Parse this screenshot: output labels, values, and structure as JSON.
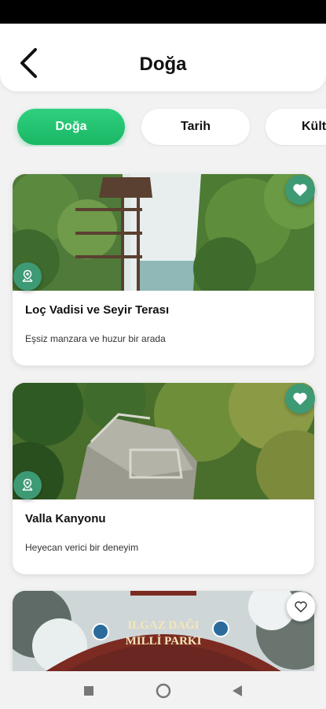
{
  "header": {
    "title": "Doğa",
    "back_icon": "chevron-left-icon"
  },
  "categories": [
    {
      "label": "Doğa",
      "active": true
    },
    {
      "label": "Tarih",
      "active": false
    },
    {
      "label": "Kült",
      "active": false
    }
  ],
  "places": [
    {
      "title": "Loç Vadisi ve Seyir Terası",
      "description": "Eşsiz manzara ve huzur bir arada",
      "favorite": true
    },
    {
      "title": "Valla Kanyonu",
      "description": "Heyecan verici bir deneyim",
      "favorite": true
    },
    {
      "title": "",
      "description": "",
      "favorite": false,
      "image_sign_text": [
        "ILGAZ DAĞI",
        "MİLLİ PARKI"
      ]
    }
  ],
  "colors": {
    "accent": "#1ab765",
    "badge": "#3d9a74"
  },
  "system_nav": {
    "icons": [
      "recent-apps-icon",
      "home-icon",
      "back-icon"
    ]
  }
}
